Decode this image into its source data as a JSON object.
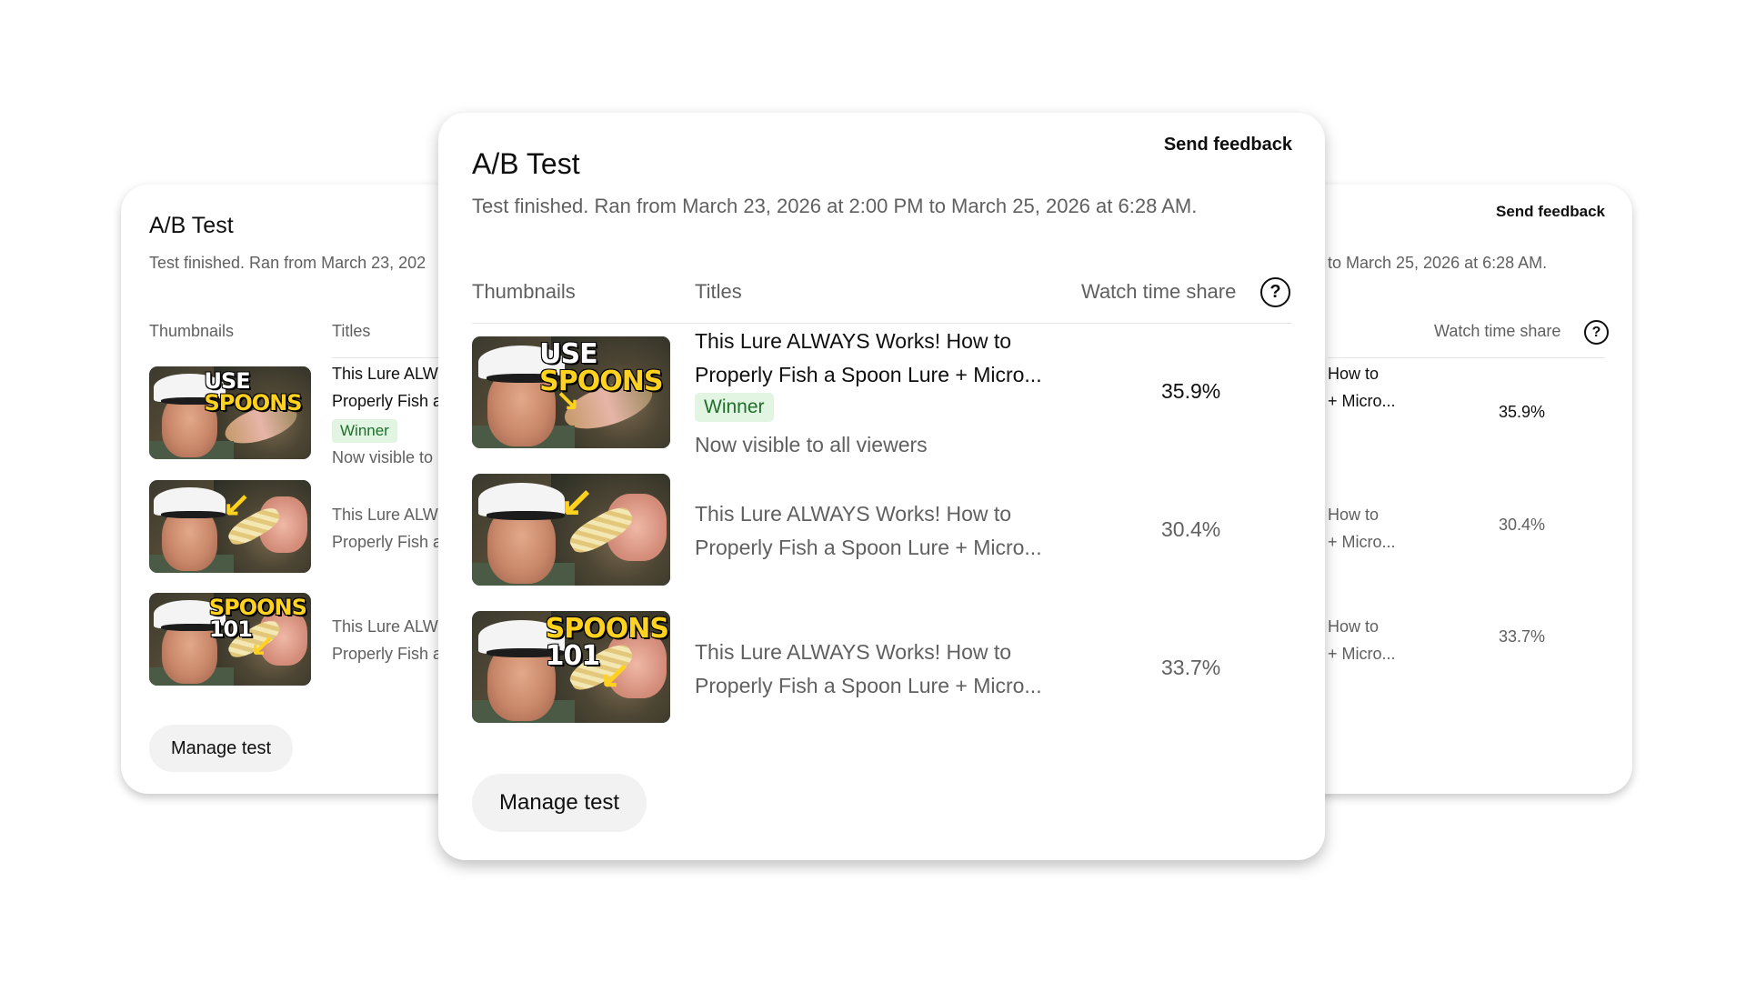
{
  "panel": {
    "title": "A/B Test",
    "send_feedback": "Send feedback",
    "status_full": "Test finished. Ran from March 23, 2026 at 2:00 PM to March 25, 2026 at 6:28 AM.",
    "status_left_clip": "Test finished. Ran from March 23, 202",
    "status_right_clip": "to March 25, 2026 at 6:28 AM.",
    "columns": {
      "thumbnails": "Thumbnails",
      "titles": "Titles",
      "watch_time_share": "Watch time share"
    },
    "help_icon": "?",
    "winner_label": "Winner",
    "visible_note": "Now visible to all viewers",
    "visible_note_clip": "Now visible to",
    "manage_button": "Manage test",
    "variants": [
      {
        "thumbnail_text": [
          "USE",
          "SPOONS"
        ],
        "title_line1": "This Lure ALWAYS Works! How to",
        "title_line2": "Properly Fish a Spoon Lure + Micro...",
        "left_line1": "This Lure ALW",
        "left_line2": "Properly Fish a",
        "right_line1": "How to",
        "right_line2": "+ Micro...",
        "share": "35.9%",
        "winner": true
      },
      {
        "thumbnail_text": [],
        "title_line1": "This Lure ALWAYS Works! How to",
        "title_line2": "Properly Fish a Spoon Lure + Micro...",
        "left_line1": "This Lure ALW",
        "left_line2": "Properly Fish a",
        "right_line1": "How to",
        "right_line2": "+ Micro...",
        "share": "30.4%",
        "winner": false
      },
      {
        "thumbnail_text": [
          "SPOONS",
          "101"
        ],
        "title_line1": "This Lure ALWAYS Works! How to",
        "title_line2": "Properly Fish a Spoon Lure + Micro...",
        "left_line1": "This Lure ALW",
        "left_line2": "Properly Fish a",
        "right_line1": "How to",
        "right_line2": "+ Micro...",
        "share": "33.7%",
        "winner": false
      }
    ]
  },
  "colors": {
    "winner_bg": "#e1f5e2",
    "winner_text": "#1e6f2a",
    "thumb_yellow": "#ffd21f",
    "button_bg": "#f2f2f2"
  }
}
